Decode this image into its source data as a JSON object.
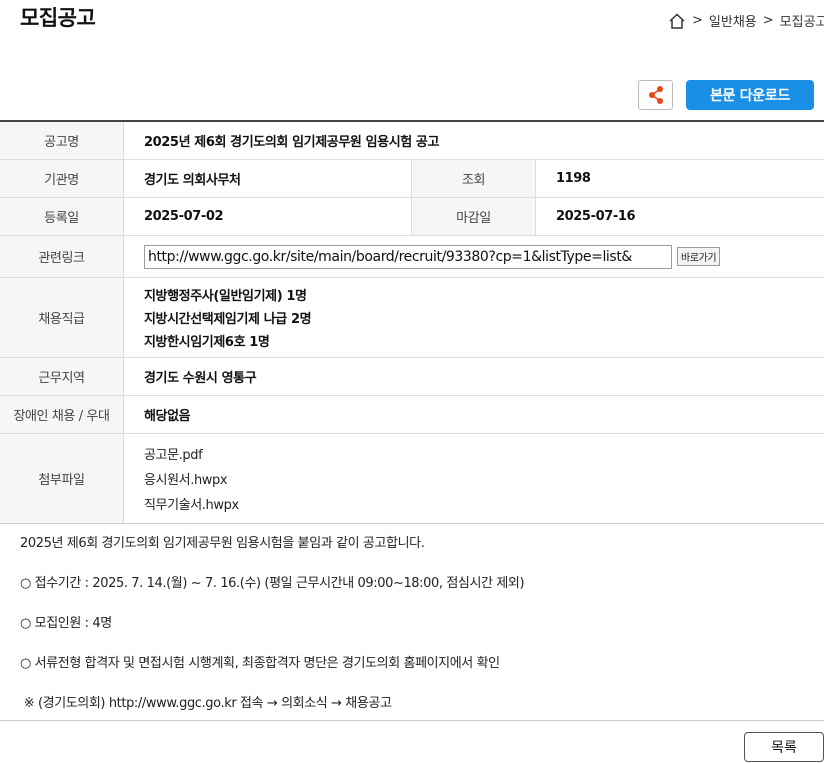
{
  "header": {
    "title": "모집공고",
    "breadcrumb": [
      ">",
      "일반채용",
      ">",
      "모집공고"
    ]
  },
  "toolbar": {
    "download_label": "본문 다운로드",
    "share_icon": "share-icon"
  },
  "info": {
    "title_label": "공고명",
    "title_value": "2025년 제6회 경기도의회 임기제공무원 임용시험 공고",
    "org_label": "기관명",
    "org_value": "경기도 의회사무처",
    "views_label": "조회",
    "views_value": "1198",
    "reg_label": "등록일",
    "reg_value": "2025-07-02",
    "deadline_label": "마감일",
    "deadline_value": "2025-07-16",
    "link_label": "관련링크",
    "link_value": "http://www.ggc.go.kr/site/main/board/recruit/93380?cp=1&listType=list&",
    "link_button": "바로가기",
    "position_label": "채용직급",
    "positions": [
      "지방행정주사(일반임기제) 1명",
      "지방시간선택제임기제 나급 2명",
      "지방한시임기제6호 1명"
    ],
    "region_label": "근무지역",
    "region_value": "경기도 수원시 영통구",
    "disabled_label": "장애인 채용 / 우대",
    "disabled_value": "해당없음",
    "files_label": "첨부파일",
    "files": [
      "공고문.pdf",
      "응시원서.hwpx",
      "직무기술서.hwpx"
    ]
  },
  "body": {
    "lines": [
      "2025년 제6회 경기도의회 임기제공무원 임용시험을 붙임과 같이 공고합니다.",
      "○ 접수기간 : 2025. 7. 14.(월) ~ 7. 16.(수) (평일 근무시간내 09:00~18:00, 점심시간 제외)",
      "○ 모집인원 : 4명",
      "○ 서류전형 합격자 및 면접시험 시행계획, 최종합격자 명단은 경기도의회 홈페이지에서 확인",
      " ※ (경기도의회) http://www.ggc.go.kr 접속 → 의회소식 → 채용공고"
    ]
  },
  "footer": {
    "list_button": "목록"
  }
}
